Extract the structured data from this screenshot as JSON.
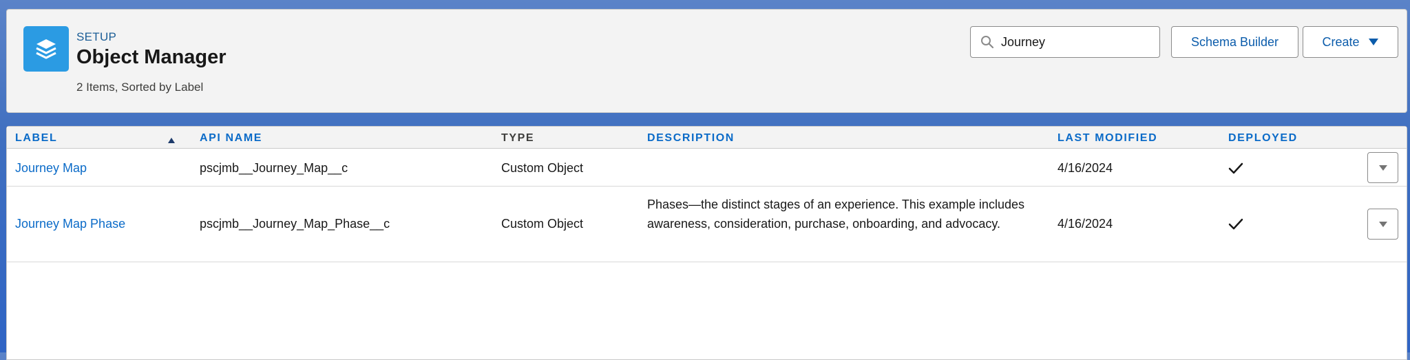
{
  "header": {
    "section": "SETUP",
    "title": "Object Manager",
    "items_info": "2 Items, Sorted by Label",
    "icon": "layers-icon"
  },
  "search": {
    "value": "Journey",
    "icon": "search-icon"
  },
  "buttons": {
    "schema_builder": "Schema Builder",
    "create": "Create"
  },
  "table": {
    "sorted_column": "label",
    "sort_direction": "ascending",
    "columns": {
      "label": "LABEL",
      "api_name": "API NAME",
      "type": "TYPE",
      "description": "DESCRIPTION",
      "last_modified": "LAST MODIFIED",
      "deployed": "DEPLOYED"
    },
    "rows": [
      {
        "label": "Journey Map",
        "api_name": "pscjmb__Journey_Map__c",
        "type": "Custom Object",
        "description": "",
        "last_modified": "4/16/2024",
        "deployed": true
      },
      {
        "label": "Journey Map Phase",
        "api_name": "pscjmb__Journey_Map_Phase__c",
        "type": "Custom Object",
        "description": "Phases—the distinct stages of an experience. This example includes awareness, consideration, purchase, onboarding, and advocacy.",
        "last_modified": "4/16/2024",
        "deployed": true
      }
    ]
  },
  "colors": {
    "brand_blue": "#2b9be3",
    "link_blue": "#0b6bc8",
    "background_blue": "#3f6fc0"
  }
}
